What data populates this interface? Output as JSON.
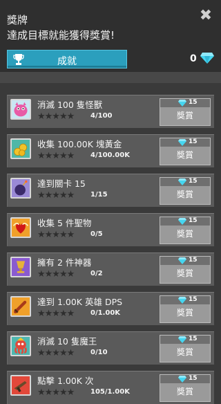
{
  "header": {
    "title": "獎牌",
    "subtitle": "達成目標就能獲得獎賞!",
    "close": "✖",
    "tab_label": "成就",
    "gem_count": "0"
  },
  "colors": {
    "accent": "#2b9fbd",
    "gem": "#45d6f0",
    "card": "#5a5a5a"
  },
  "achievements": [
    {
      "name": "消滅 100 隻怪獸",
      "progress": "4/100",
      "reward": "15",
      "claim": "獎賞",
      "icon": "pink-monster-icon"
    },
    {
      "name": "收集 100.00K 塊黃金",
      "progress": "4/100.00K",
      "reward": "15",
      "claim": "獎賞",
      "icon": "gold-coins-icon"
    },
    {
      "name": "達到關卡 15",
      "progress": "1/15",
      "reward": "15",
      "claim": "獎賞",
      "icon": "bomb-icon"
    },
    {
      "name": "收集 5 件聖物",
      "progress": "0/5",
      "reward": "15",
      "claim": "獎賞",
      "icon": "relic-heart-icon"
    },
    {
      "name": "擁有 2 件神器",
      "progress": "0/2",
      "reward": "15",
      "claim": "獎賞",
      "icon": "artifact-cup-icon"
    },
    {
      "name": "達到 1.00K 英雄 DPS",
      "progress": "0/1.00K",
      "reward": "15",
      "claim": "獎賞",
      "icon": "sword-icon"
    },
    {
      "name": "消滅 10 隻魔王",
      "progress": "0/10",
      "reward": "15",
      "claim": "獎賞",
      "icon": "boss-octopus-icon"
    },
    {
      "name": "點擊 1.00K 次",
      "progress": "105/1.00K",
      "reward": "15",
      "claim": "獎賞",
      "icon": "gun-icon"
    }
  ],
  "stars": "★★★★★"
}
